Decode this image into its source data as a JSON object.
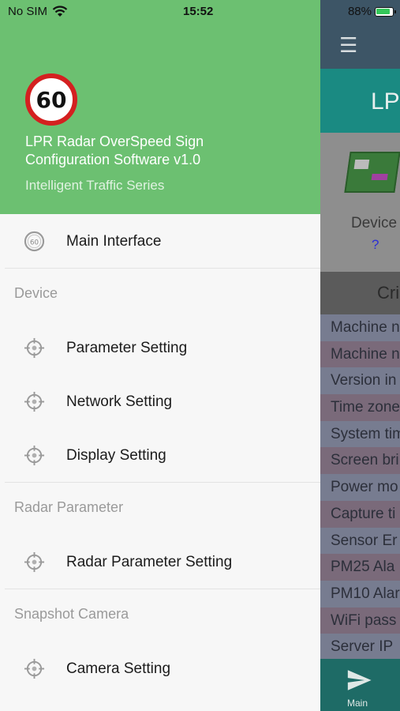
{
  "status_bar": {
    "carrier": "No SIM",
    "time": "15:52",
    "battery_percent": "88%",
    "battery_level": 0.88
  },
  "drawer": {
    "speed_sign_number": "60",
    "app_title_line1": "LPR Radar OverSpeed Sign",
    "app_title_line2": "Configuration Software v1.0",
    "app_subtitle": "Intelligent Traffic Series",
    "main_item": {
      "label": "Main Interface",
      "icon": "speed-limit-60-icon"
    },
    "sections": [
      {
        "header": "Device",
        "items": [
          {
            "label": "Parameter Setting",
            "icon": "crosshair-icon"
          },
          {
            "label": "Network Setting",
            "icon": "crosshair-icon"
          },
          {
            "label": "Display Setting",
            "icon": "crosshair-icon"
          }
        ]
      },
      {
        "header": "Radar Parameter",
        "items": [
          {
            "label": "Radar Parameter Setting",
            "icon": "crosshair-icon"
          }
        ]
      },
      {
        "header": "Snapshot Camera",
        "items": [
          {
            "label": "Camera Setting",
            "icon": "crosshair-icon"
          }
        ]
      }
    ],
    "header_color": "#6cc071"
  },
  "background_screen": {
    "menu_icon": "hamburger-icon",
    "title_fragment": "LPR",
    "device_label_fragment": "Device",
    "device_question": "?",
    "section_fragment": "Cri",
    "rows": [
      "Machine n",
      "Machine n",
      "Version in",
      "Time zone",
      "System tim",
      "Screen bri",
      "Power mo",
      "Capture ti",
      "Sensor Er",
      "PM25 Ala",
      "PM10 Alar",
      "WiFi pass",
      "Server IP"
    ],
    "tab_label": "Main",
    "tab_icon": "send-icon"
  }
}
